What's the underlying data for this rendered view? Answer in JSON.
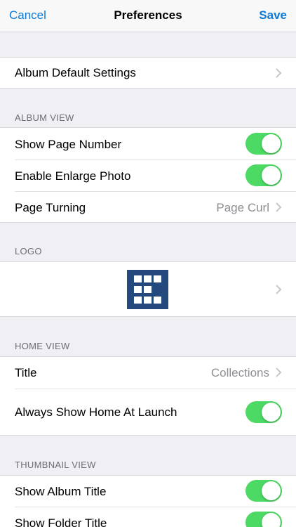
{
  "nav": {
    "cancel": "Cancel",
    "title": "Preferences",
    "save": "Save"
  },
  "general": {
    "album_default_settings": "Album Default Settings"
  },
  "album_view": {
    "header": "ALBUM VIEW",
    "show_page_number": {
      "label": "Show Page Number",
      "on": true
    },
    "enable_enlarge_photo": {
      "label": "Enable Enlarge Photo",
      "on": true
    },
    "page_turning": {
      "label": "Page Turning",
      "value": "Page Curl"
    }
  },
  "logo_section": {
    "header": "LOGO"
  },
  "home_view": {
    "header": "HOME VIEW",
    "title": {
      "label": "Title",
      "value": "Collections"
    },
    "always_show_home": {
      "label": "Always Show Home At Launch",
      "on": true
    }
  },
  "thumbnail_view": {
    "header": "THUMBNAIL VIEW",
    "show_album_title": {
      "label": "Show Album Title",
      "on": true
    },
    "show_folder_title": {
      "label": "Show Folder Title",
      "on": true
    }
  },
  "colors": {
    "accent": "#0a7ad6",
    "toggle_on": "#4cd964",
    "logo_bg": "#244a7d"
  }
}
